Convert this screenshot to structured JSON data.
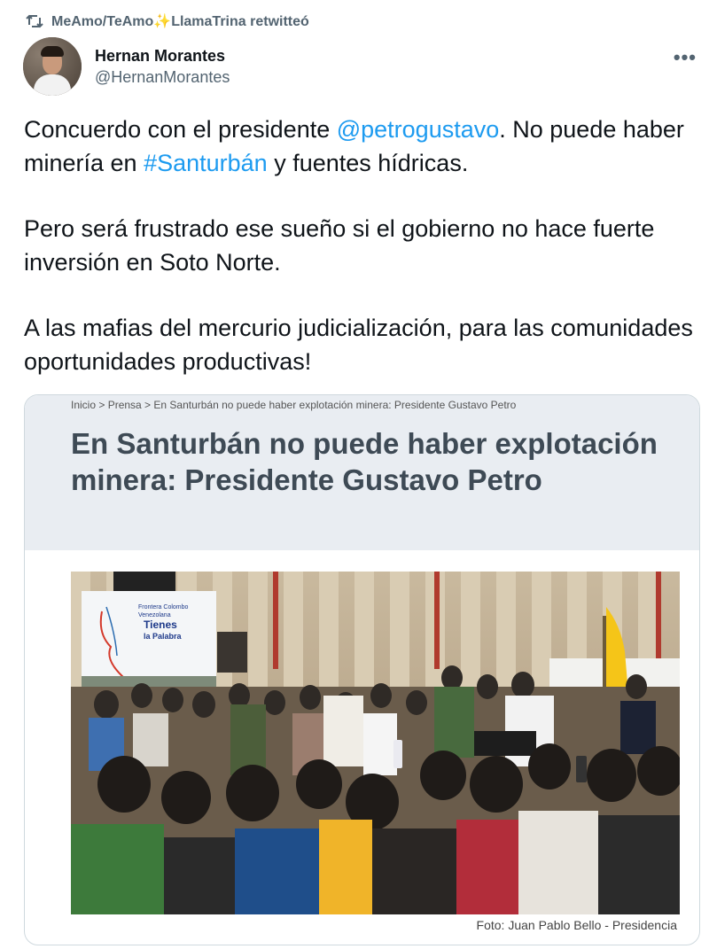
{
  "retweet": {
    "icon": "retweet-icon",
    "text": "MeAmo/TeAmo",
    "sparkle": "✨",
    "text2": "LlamaTrina retwitteó"
  },
  "author": {
    "display_name": "Hernan Morantes",
    "handle": "@HernanMorantes",
    "more": "•••"
  },
  "tweet": {
    "p1_a": "Concuerdo con el presidente ",
    "p1_mention": "@petrogustavo",
    "p1_b": ". No puede haber minería en ",
    "p1_hashtag": "#Santurbán",
    "p1_c": " y fuentes hídricas.",
    "p2": "Pero será frustrado ese sueño si el gobierno no hace fuerte inversión en Soto Norte.",
    "p3": "A las mafias del mercurio judicialización, para las comunidades oportunidades productivas!"
  },
  "card": {
    "breadcrumb": "Inicio > Prensa > En Santurbán no puede haber explotación minera: Presidente Gustavo Petro",
    "headline": "En Santurbán no puede haber explotación minera: Presidente Gustavo Petro",
    "banner_line1": "Frontera Colombo",
    "banner_line2": "Venezolana",
    "banner_line3": "Tienes",
    "banner_line4": "la Palabra",
    "caption": "Foto: Juan Pablo Bello - Presidencia"
  },
  "colors": {
    "link": "#1d9bf0",
    "muted": "#536471",
    "card_head_bg": "#e9edf2",
    "headline": "#3e4a55"
  }
}
